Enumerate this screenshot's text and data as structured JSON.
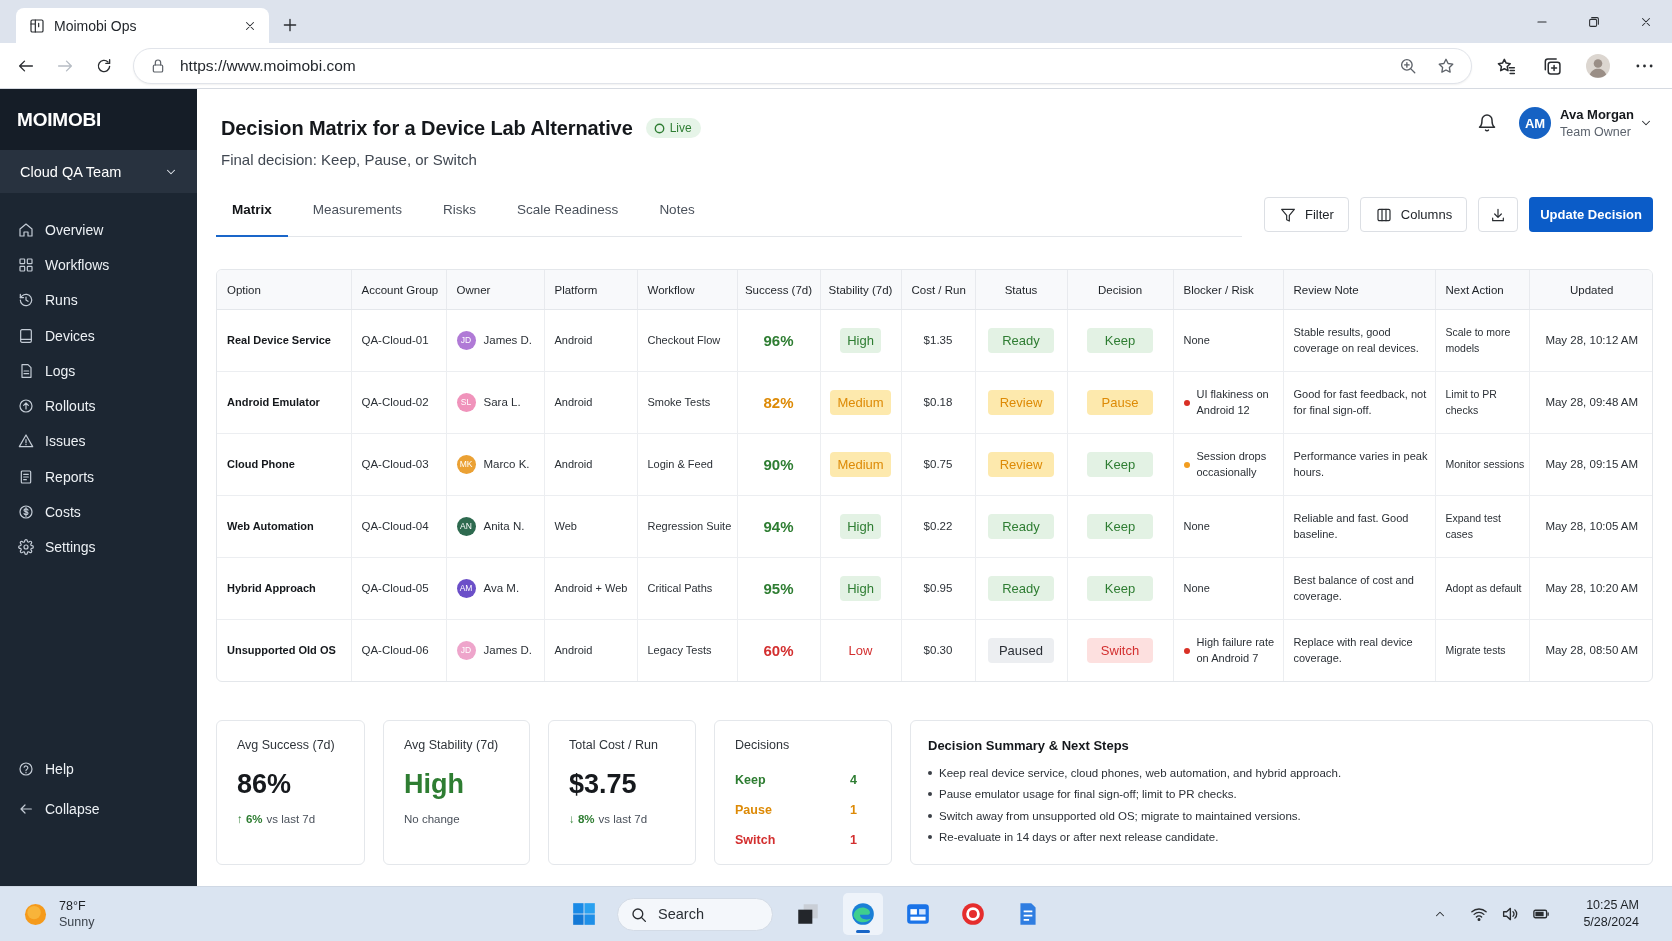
{
  "browser": {
    "tab": {
      "title": "Moimobi Ops"
    },
    "navigation": {
      "forward_disabled": true
    },
    "address": "https://www.moimobi.com"
  },
  "sidebar": {
    "logo": "MOIMOBI",
    "team": "Cloud QA Team",
    "items": [
      {
        "label": "Overview"
      },
      {
        "label": "Workflows"
      },
      {
        "label": "Runs"
      },
      {
        "label": "Devices"
      },
      {
        "label": "Logs"
      },
      {
        "label": "Rollouts"
      },
      {
        "label": "Issues"
      },
      {
        "label": "Reports"
      },
      {
        "label": "Costs"
      },
      {
        "label": "Settings"
      }
    ],
    "footer": [
      {
        "label": "Help"
      },
      {
        "label": "Collapse"
      }
    ]
  },
  "header": {
    "title": "Decision Matrix for a Device Lab Alternative",
    "status_badge": "Live",
    "subtitle": "Final decision: Keep, Pause, or Switch",
    "user": {
      "initials": "AM",
      "name": "Ava Morgan",
      "role": "Team Owner"
    }
  },
  "tabs": [
    {
      "label": "Matrix",
      "selected": true
    },
    {
      "label": "Measurements",
      "selected": false
    },
    {
      "label": "Risks",
      "selected": false
    },
    {
      "label": "Scale Readiness",
      "selected": false
    },
    {
      "label": "Notes",
      "selected": false
    }
  ],
  "actions": [
    {
      "kind": "filter",
      "label": "Filter"
    },
    {
      "kind": "columns",
      "label": "Columns"
    },
    {
      "kind": "download"
    },
    {
      "kind": "primary",
      "label": "Update Decision"
    }
  ],
  "table": {
    "columns": [
      "Option",
      "Account Group",
      "Owner",
      "Platform",
      "Workflow",
      "Success (7d)",
      "Stability (7d)",
      "Cost / Run",
      "Status",
      "Decision",
      "Blocker / Risk",
      "Review Note",
      "Next Action",
      "Updated"
    ],
    "rows": [
      {
        "option": "Real Device Service",
        "account_group": "QA-Cloud-01",
        "owner": {
          "initials": "JD",
          "name": "James D.",
          "color": "#b07ad6"
        },
        "platform": "Android",
        "workflow": "Checkout Flow",
        "success": {
          "text": "96%",
          "color": "#2e7d32"
        },
        "stability": {
          "text": "High",
          "color": "#2e7d32",
          "kind": "badge"
        },
        "cost": "$1.35",
        "status": {
          "text": "Ready",
          "color": "#2e7d32"
        },
        "decision": {
          "text": "Keep",
          "color": "#2e7d32"
        },
        "blocker": {
          "text": "None"
        },
        "review_note": "Stable results, good coverage on real devices.",
        "next_action": "Scale to more models",
        "updated": "May 28, 10:12 AM"
      },
      {
        "option": "Android Emulator",
        "account_group": "QA-Cloud-02",
        "owner": {
          "initials": "SL",
          "name": "Sara L.",
          "color": "#f093bb"
        },
        "platform": "Android",
        "workflow": "Smoke Tests",
        "success": {
          "text": "82%",
          "color": "#dd8a06"
        },
        "stability": {
          "text": "Medium",
          "color": "#dd8a06",
          "kind": "badge"
        },
        "cost": "$0.18",
        "status": {
          "text": "Review",
          "color": "#dd8a06"
        },
        "decision": {
          "text": "Pause",
          "color": "#dd8a06"
        },
        "blocker": {
          "text": "UI flakiness on Android 12",
          "color": "#d93025"
        },
        "review_note": "Good for fast feedback, not for final sign-off.",
        "next_action": "Limit to PR checks",
        "updated": "May 28, 09:48 AM"
      },
      {
        "option": "Cloud Phone",
        "account_group": "QA-Cloud-03",
        "owner": {
          "initials": "MK",
          "name": "Marco K.",
          "color": "#eba134"
        },
        "platform": "Android",
        "workflow": "Login & Feed",
        "success": {
          "text": "90%",
          "color": "#2e7d32"
        },
        "stability": {
          "text": "Medium",
          "color": "#dd8a06",
          "kind": "badge"
        },
        "cost": "$0.75",
        "status": {
          "text": "Review",
          "color": "#dd8a06"
        },
        "decision": {
          "text": "Keep",
          "color": "#2e7d32"
        },
        "blocker": {
          "text": "Session drops occasionally",
          "color": "#f29d1f"
        },
        "review_note": "Performance varies in peak hours.",
        "next_action": "Monitor sessions",
        "updated": "May 28, 09:15 AM"
      },
      {
        "option": "Web Automation",
        "account_group": "QA-Cloud-04",
        "owner": {
          "initials": "AN",
          "name": "Anita N.",
          "color": "#2e6a4f"
        },
        "platform": "Web",
        "workflow": "Regression Suite",
        "success": {
          "text": "94%",
          "color": "#2e7d32"
        },
        "stability": {
          "text": "High",
          "color": "#2e7d32",
          "kind": "badge"
        },
        "cost": "$0.22",
        "status": {
          "text": "Ready",
          "color": "#2e7d32"
        },
        "decision": {
          "text": "Keep",
          "color": "#2e7d32"
        },
        "blocker": {
          "text": "None"
        },
        "review_note": "Reliable and fast. Good baseline.",
        "next_action": "Expand test cases",
        "updated": "May 28, 10:05 AM"
      },
      {
        "option": "Hybrid Approach",
        "account_group": "QA-Cloud-05",
        "owner": {
          "initials": "AM",
          "name": "Ava M.",
          "color": "#6b4fc8"
        },
        "platform": "Android + Web",
        "workflow": "Critical Paths",
        "success": {
          "text": "95%",
          "color": "#2e7d32"
        },
        "stability": {
          "text": "High",
          "color": "#2e7d32",
          "kind": "badge"
        },
        "cost": "$0.95",
        "status": {
          "text": "Ready",
          "color": "#2e7d32"
        },
        "decision": {
          "text": "Keep",
          "color": "#2e7d32"
        },
        "blocker": {
          "text": "None"
        },
        "review_note": "Best balance of cost and coverage.",
        "next_action": "Adopt as default",
        "updated": "May 28, 10:20 AM"
      },
      {
        "option": "Unsupported Old OS",
        "account_group": "QA-Cloud-06",
        "owner": {
          "initials": "JD",
          "name": "James D.",
          "color": "#eea5cb"
        },
        "platform": "Android",
        "workflow": "Legacy Tests",
        "success": {
          "text": "60%",
          "color": "#d32f2f"
        },
        "stability": {
          "text": "Low",
          "color": "#d32f2f",
          "kind": "text"
        },
        "cost": "$0.30",
        "status": {
          "text": "Paused",
          "color": "#2b2f36"
        },
        "decision": {
          "text": "Switch",
          "color": "#d32f2f"
        },
        "blocker": {
          "text": "High failure rate on Android 7",
          "color": "#d93025"
        },
        "review_note": "Replace with real device coverage.",
        "next_action": "Migrate tests",
        "updated": "May 28, 08:50 AM"
      }
    ]
  },
  "kpis": [
    {
      "label": "Avg Success (7d)",
      "value": "86%",
      "color": "#16191d",
      "note": {
        "change": "↑ 6%",
        "text": "vs last 7d"
      }
    },
    {
      "label": "Avg Stability (7d)",
      "value": "High",
      "color": "#2e7d32",
      "note": {
        "text": "No change"
      }
    },
    {
      "label": "Total Cost / Run",
      "value": "$3.75",
      "color": "#16191d",
      "note": {
        "change": "↓ 8%",
        "text": "vs last 7d"
      }
    }
  ],
  "decisions": {
    "title": "Decisions",
    "items": [
      {
        "label": "Keep",
        "count": "4",
        "color": "#2e7d32"
      },
      {
        "label": "Pause",
        "count": "1",
        "color": "#dd8a06"
      },
      {
        "label": "Switch",
        "count": "1",
        "color": "#d32f2f"
      }
    ]
  },
  "next_steps": {
    "title": "Decision Summary & Next Steps",
    "items": [
      "Keep real device service, cloud phones, web automation, and hybrid approach.",
      "Pause emulator usage for final sign-off; limit to PR checks.",
      "Switch away from unsupported old OS; migrate to maintained versions.",
      "Re-evaluate in 14 days or after next release candidate."
    ]
  },
  "taskbar": {
    "weather": {
      "temperature": "78°F",
      "condition": "Sunny"
    },
    "search": {
      "placeholder": "Search"
    },
    "apps": [
      {
        "kind": "window",
        "selected": false
      },
      {
        "kind": "browser",
        "selected": true
      },
      {
        "kind": "calendar",
        "selected": false
      },
      {
        "kind": "media",
        "selected": false
      },
      {
        "kind": "document",
        "selected": false
      }
    ],
    "clock": {
      "time": "10:25 AM",
      "date": "5/28/2024"
    }
  }
}
